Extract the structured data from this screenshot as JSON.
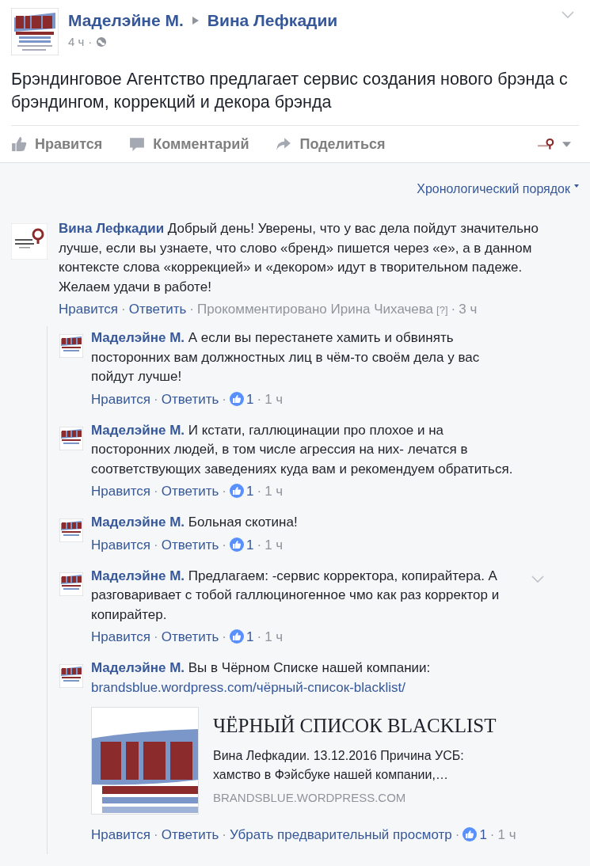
{
  "separator": "·",
  "post": {
    "author": "Маделэйне М.",
    "target": "Вина Лефкадии",
    "time": "4 ч",
    "text": "Брэндинговое Агентство предлагает сервис создания нового брэнда с брэндингом, коррекций и декора брэнда",
    "actions": [
      {
        "kind": "like",
        "label": "Нравится"
      },
      {
        "kind": "comment",
        "label": "Комментарий"
      },
      {
        "kind": "share",
        "label": "Поделиться"
      }
    ]
  },
  "sort_label": "Хронологический порядок",
  "comments": [
    {
      "author": "Вина Лефкадии",
      "text": "Добрый день! Уверены, что у вас дела пойдут значительно лучше, если вы узнаете, что слово «бренд» пишется через «е», а в данном контексте слова «коррекцией» и «декором» идут в творительном падеже. Желаем удачи в работе!",
      "meta": [
        {
          "kind": "link",
          "text": "Нравится"
        },
        {
          "kind": "link",
          "text": "Ответить"
        },
        {
          "kind": "muted",
          "text": "Прокомментировано Ирина Чихачева"
        },
        {
          "kind": "help",
          "text": "[?]"
        },
        {
          "kind": "time",
          "text": "3 ч"
        }
      ],
      "replies": [
        {
          "author": "Маделэйне М.",
          "text": "А если вы перестанете хамить и обвинять посторонних вам должностных лиц в чём-то своём дела у вас пойдут лучше!",
          "menu": false,
          "meta": [
            {
              "kind": "link",
              "text": "Нравится"
            },
            {
              "kind": "link",
              "text": "Ответить"
            },
            {
              "kind": "likes",
              "text": "1"
            },
            {
              "kind": "time",
              "text": "1 ч"
            }
          ]
        },
        {
          "author": "Маделэйне М.",
          "text": "И кстати, галлюцинации про плохое и на посторонних людей, в том числе агрессия на них- лечатся в соответствующих заведениях куда вам и рекомендуем обратиться.",
          "menu": false,
          "meta": [
            {
              "kind": "link",
              "text": "Нравится"
            },
            {
              "kind": "link",
              "text": "Ответить"
            },
            {
              "kind": "likes",
              "text": "1"
            },
            {
              "kind": "time",
              "text": "1 ч"
            }
          ]
        },
        {
          "author": "Маделэйне М.",
          "text": "Больная скотина!",
          "menu": false,
          "meta": [
            {
              "kind": "link",
              "text": "Нравится"
            },
            {
              "kind": "link",
              "text": "Ответить"
            },
            {
              "kind": "likes",
              "text": "1"
            },
            {
              "kind": "time",
              "text": "1 ч"
            }
          ]
        },
        {
          "author": "Маделэйне М.",
          "text": "Предлагаем: -сервис корректора, копирайтера. А разговаривает с тобой галлюциногенное чмо как раз корректор и копирайтер.",
          "menu": true,
          "meta": [
            {
              "kind": "link",
              "text": "Нравится"
            },
            {
              "kind": "link",
              "text": "Ответить"
            },
            {
              "kind": "likes",
              "text": "1"
            },
            {
              "kind": "time",
              "text": "1 ч"
            }
          ]
        },
        {
          "author": "Маделэйне М.",
          "text": "Вы в Чёрном Списке нашей компании:",
          "menu": false,
          "link": "brandsblue.wordpress.com/чёрный-список-blacklist/",
          "preview": {
            "kind": "picture",
            "title": "ЧЁРНЫЙ СПИСОК BLACKLIST",
            "description": "Вина Лефкадии. 13.12.2016 Причина УСБ: хамство в Фэйсбуке нашей компании,…",
            "domain": "BRANDSBLUE.WORDPRESS.COM"
          },
          "meta": [
            {
              "kind": "link",
              "text": "Нравится"
            },
            {
              "kind": "link",
              "text": "Ответить"
            },
            {
              "kind": "link",
              "text": "Убрать предварительный просмотр"
            },
            {
              "kind": "likes",
              "text": "1"
            },
            {
              "kind": "time",
              "text": "1 ч"
            }
          ]
        }
      ]
    }
  ]
}
